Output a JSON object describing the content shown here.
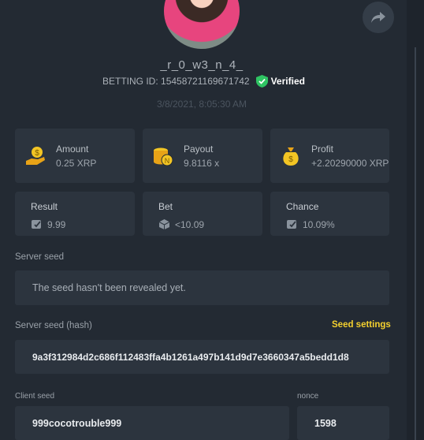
{
  "profile": {
    "username": "_r_0_w3_n_4_",
    "betting_id_label": "BETTING ID:",
    "betting_id": "15458721169671742",
    "verified_label": "Verified",
    "timestamp": "3/8/2021, 8:05:30 AM"
  },
  "stats": {
    "amount": {
      "label": "Amount",
      "value": "0.25 XRP",
      "icon": "coin-hand-icon"
    },
    "payout": {
      "label": "Payout",
      "value": "9.8116 x",
      "icon": "coin-stack-icon"
    },
    "profit": {
      "label": "Profit",
      "value": "+2.20290000 XRP",
      "icon": "money-bag-icon"
    }
  },
  "details": {
    "result": {
      "label": "Result",
      "value": "9.99"
    },
    "bet": {
      "label": "Bet",
      "value": "<10.09"
    },
    "chance": {
      "label": "Chance",
      "value": "10.09%"
    }
  },
  "server_seed": {
    "label": "Server seed",
    "value": "The seed hasn't been revealed yet."
  },
  "server_seed_hash": {
    "label": "Server seed (hash)",
    "value": "9a3f312984d2c686f112483ffa4b1261a497b141d9d7e3660347a5bedd1d8",
    "settings_link": "Seed settings"
  },
  "client_seed": {
    "label": "Client seed",
    "value": "999cocotrouble999"
  },
  "nonce": {
    "label": "nonce",
    "value": "1598"
  },
  "colors": {
    "background": "#232a33",
    "card": "#2c343e",
    "accent_yellow": "#f5d12e",
    "verified_green": "#2fc463"
  }
}
